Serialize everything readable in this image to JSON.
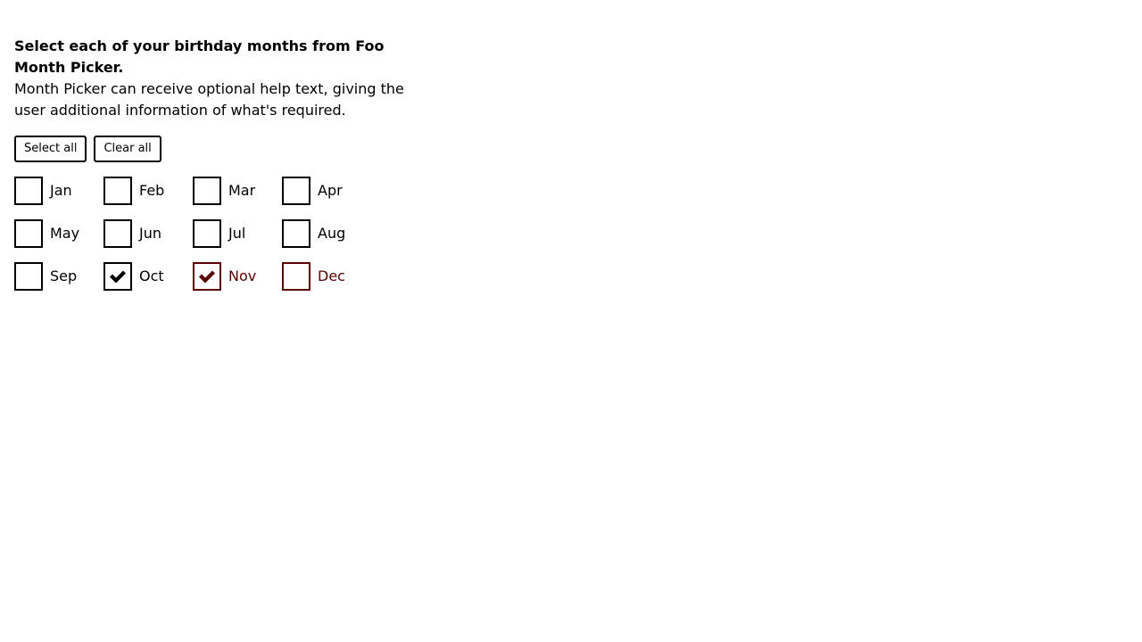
{
  "form": {
    "title": "Select each of your birthday months from Foo Month Picker.",
    "help_text": "Month Picker can receive optional help text, giving the user additional information of what's required."
  },
  "actions": {
    "select_all_label": "Select all",
    "clear_all_label": "Clear all"
  },
  "colors": {
    "text": "#000000",
    "error": "#5a0000",
    "border": "#000000"
  },
  "months": [
    {
      "label": "Jan",
      "checked": false,
      "error": false
    },
    {
      "label": "Feb",
      "checked": false,
      "error": false
    },
    {
      "label": "Mar",
      "checked": false,
      "error": false
    },
    {
      "label": "Apr",
      "checked": false,
      "error": false
    },
    {
      "label": "May",
      "checked": false,
      "error": false
    },
    {
      "label": "Jun",
      "checked": false,
      "error": false
    },
    {
      "label": "Jul",
      "checked": false,
      "error": false
    },
    {
      "label": "Aug",
      "checked": false,
      "error": false
    },
    {
      "label": "Sep",
      "checked": false,
      "error": false
    },
    {
      "label": "Oct",
      "checked": true,
      "error": false
    },
    {
      "label": "Nov",
      "checked": true,
      "error": true
    },
    {
      "label": "Dec",
      "checked": false,
      "error": true
    }
  ]
}
